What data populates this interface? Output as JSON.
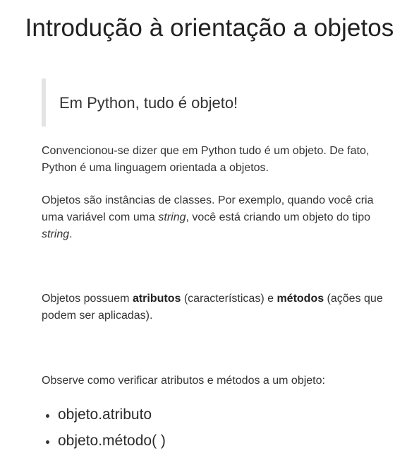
{
  "title": "Introdução à orientação a objetos",
  "callout": {
    "text": "Em Python, tudo é objeto!"
  },
  "paragraphs": {
    "p1": {
      "text": "Convencionou-se dizer que em Python tudo é um objeto. De fato, Python é uma linguagem orientada a objetos."
    },
    "p2": {
      "part1": "Objetos são instâncias de classes. Por exemplo, quando você cria uma variável com uma ",
      "em1": "string",
      "part2": ", você está criando um objeto do tipo  ",
      "em2": "string",
      "part3": "."
    },
    "p3": {
      "part1": "Objetos possuem ",
      "bold1": "atributos",
      "part2": " (características) e ",
      "bold2": "métodos",
      "part3": " (ações que podem ser aplicadas)."
    },
    "p4": {
      "text": "Observe como verificar atributos e métodos a um objeto:"
    }
  },
  "bullets": [
    "objeto.atributo",
    "objeto.método( )"
  ]
}
